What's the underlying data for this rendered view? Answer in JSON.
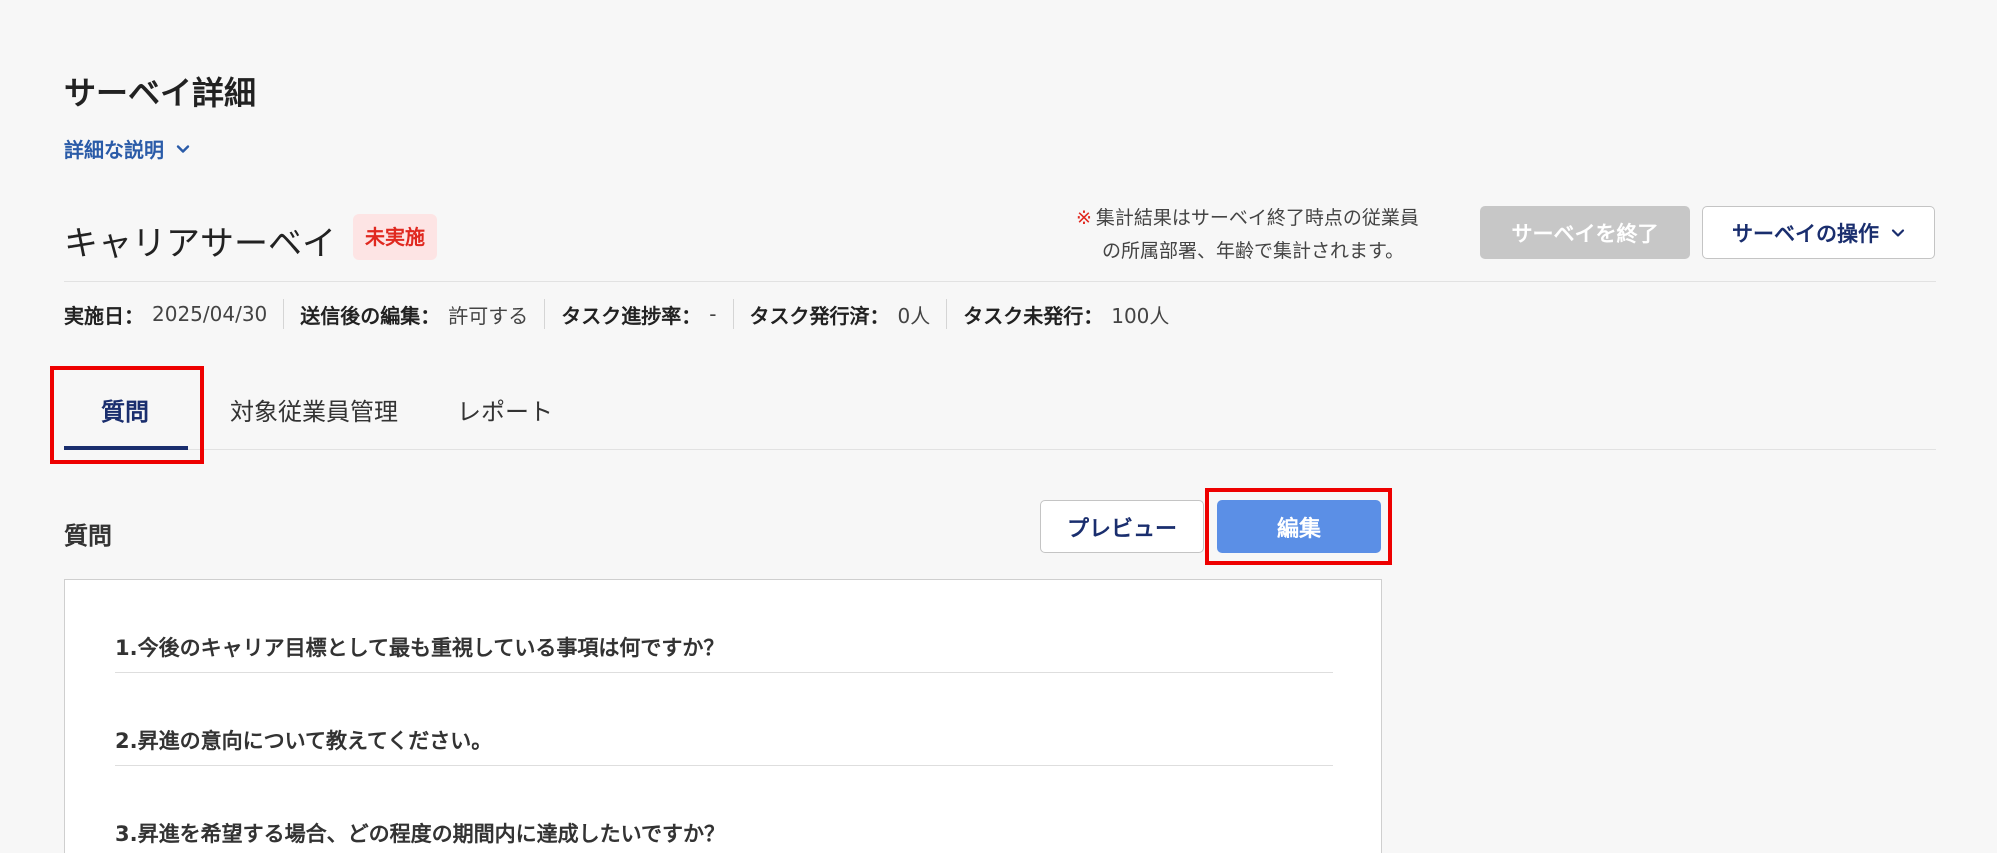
{
  "page": {
    "title": "サーベイ詳細",
    "desc_toggle": "詳細な説明"
  },
  "survey": {
    "name": "キャリアサーベイ",
    "status": "未実施",
    "note_mark": "※",
    "note_line1": "集計結果はサーベイ終了時点の従業員",
    "note_line2": "の所属部署、年齢で集計されます。",
    "end_button": "サーベイを終了",
    "ops_button": "サーベイの操作"
  },
  "meta": [
    {
      "label": "実施日：",
      "value": "2025/04/30"
    },
    {
      "label": "送信後の編集：",
      "value": "許可する"
    },
    {
      "label": "タスク進捗率：",
      "value": "-"
    },
    {
      "label": "タスク発行済：",
      "value": "0人"
    },
    {
      "label": "タスク未発行：",
      "value": "100人"
    }
  ],
  "tabs": [
    {
      "label": "質問",
      "active": true
    },
    {
      "label": "対象従業員管理",
      "active": false
    },
    {
      "label": "レポート",
      "active": false
    }
  ],
  "questions_section": {
    "label": "質問",
    "preview_button": "プレビュー",
    "edit_button": "編集",
    "items": [
      "1.今後のキャリア目標として最も重視している事項は何ですか？",
      "2.昇進の意向について教えてください。",
      "3.昇進を希望する場合、どの程度の期間内に達成したいですか？"
    ]
  },
  "colors": {
    "accent": "#1a2e6e",
    "link": "#2a5ba8",
    "primary_button": "#5b8fe6",
    "status_red": "#e0281f",
    "highlight_red": "#ee0000"
  }
}
